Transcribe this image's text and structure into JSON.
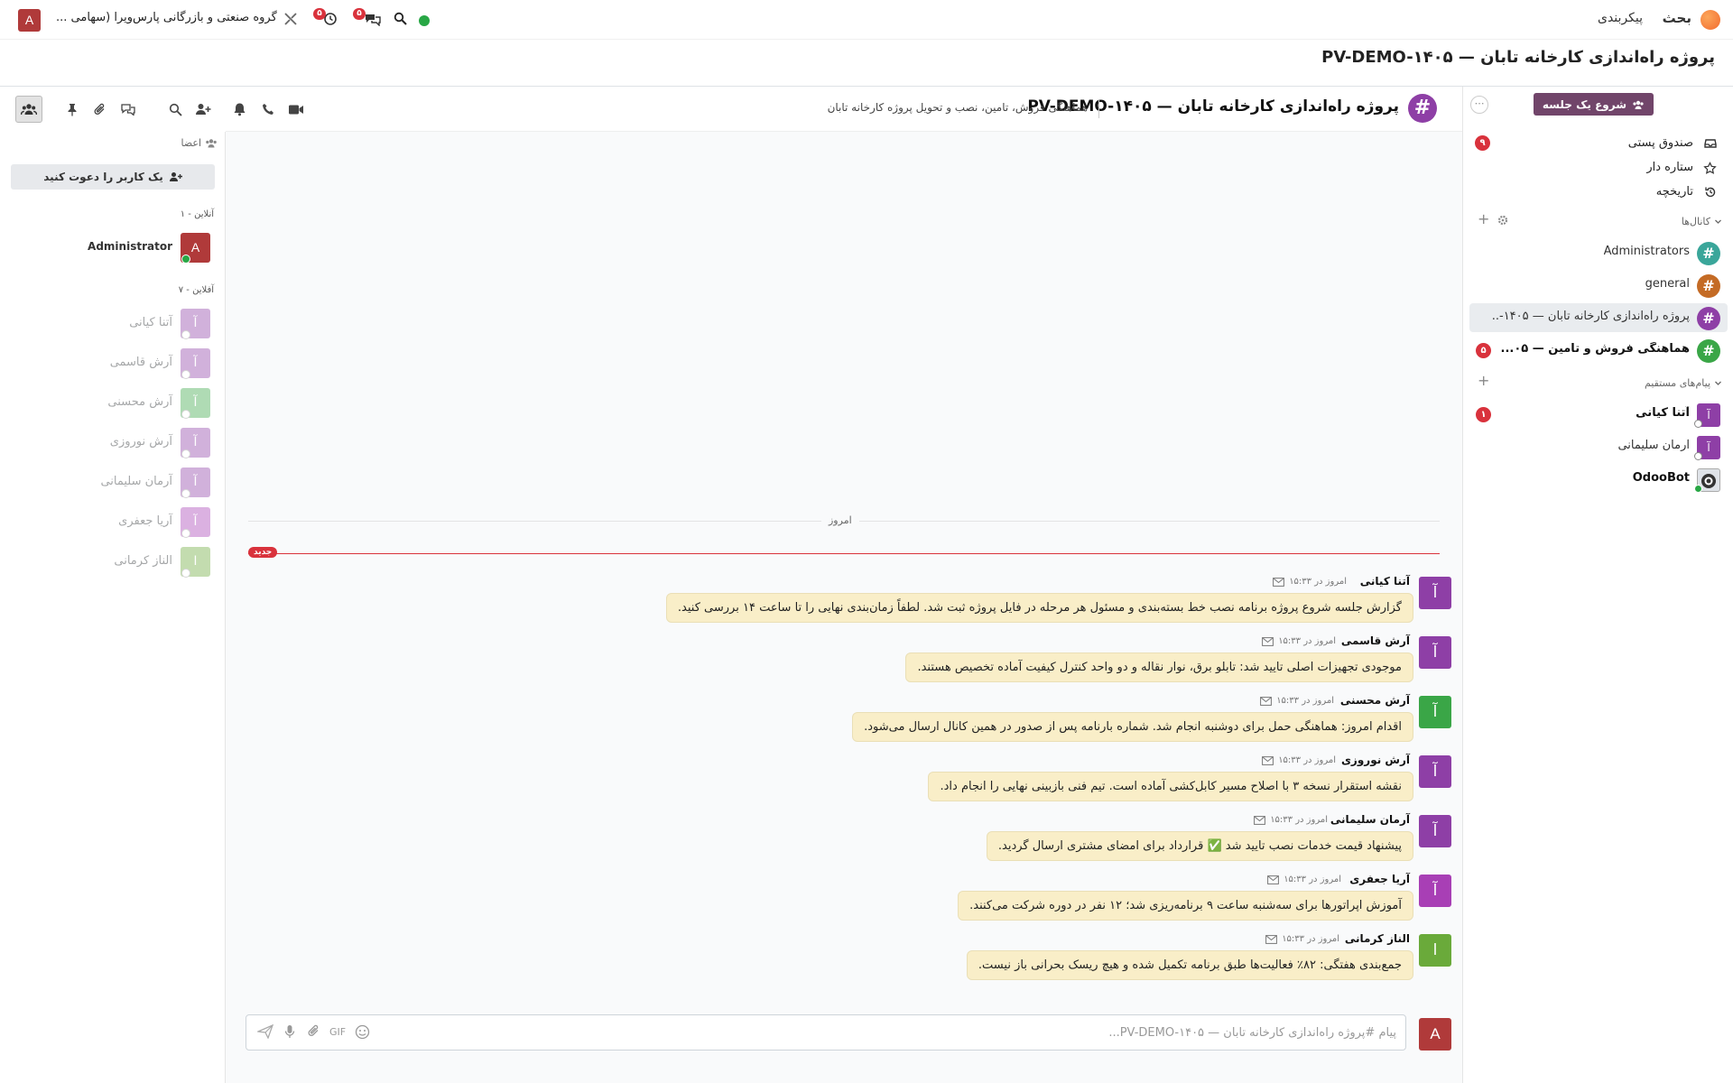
{
  "navbar": {
    "app_name": "بحث",
    "menu_item": "پیکربندی",
    "company": "گروه صنعتی و بازرگانی پارس‌ویرا (سهامی ...",
    "user_initial": "A",
    "messages_badge": "۵",
    "activity_badge": "۵"
  },
  "breadcrumb": {
    "title": "پروژه راه‌اندازی کارخانه تابان — PV-DEMO-۱۴۰۵"
  },
  "sidebar": {
    "start_meeting": "شروع یک جلسه",
    "mailboxes": [
      {
        "label": "صندوق پستی",
        "icon": "inbox-icon",
        "badge": "۹"
      },
      {
        "label": "ستاره دار",
        "icon": "star-icon",
        "badge": ""
      },
      {
        "label": "تاریخچه",
        "icon": "history-icon",
        "badge": ""
      }
    ],
    "channels_header": "کانال‌ها",
    "channels": [
      {
        "name": "Administrators",
        "color": "#3aa69a",
        "bold": false,
        "active": false,
        "badge": ""
      },
      {
        "name": "general",
        "color": "#c46b25",
        "bold": false,
        "active": false,
        "badge": ""
      },
      {
        "name": "پروژه راه‌اندازی کارخانه تابان — ۱۴۰۵-...",
        "color": "#8e3fa6",
        "bold": false,
        "active": true,
        "badge": ""
      },
      {
        "name": "هماهنگی فروش و تامین — ۰۵...",
        "color": "#3aa647",
        "bold": true,
        "active": false,
        "badge": "۵"
      }
    ],
    "dm_header": "پیام‌های مستقیم",
    "direct_messages": [
      {
        "name": "آتنا کیانی",
        "initial": "آ",
        "color": "#8e3fa6",
        "bold": true,
        "badge": "۱",
        "online": false
      },
      {
        "name": "آرمان سلیمانی",
        "initial": "آ",
        "color": "#8e3fa6",
        "bold": false,
        "badge": "",
        "online": false
      },
      {
        "name": "OdooBot",
        "initial": "",
        "color": "#444",
        "bold": true,
        "badge": "",
        "online": true
      }
    ]
  },
  "channel": {
    "name": "پروژه راه‌اندازی کارخانه تابان — PV-DEMO-۱۴۰۵",
    "description": "هماهنگی فروش، تامین، نصب و تحویل پروژه کارخانه تابان"
  },
  "thread": {
    "day_label": "امروز",
    "new_label": "جدید",
    "messages": [
      {
        "author": "آتنا کیانی",
        "initial": "آ",
        "color": "#8e3fa6",
        "time": "امروز در ۱۵:۳۳",
        "text": "گزارش جلسه شروع پروژه برنامه نصب خط بسته‌بندی و مسئول هر مرحله در فایل پروژه ثبت شد. لطفاً زمان‌بندی نهایی را تا ساعت ۱۴ بررسی کنید."
      },
      {
        "author": "آرش قاسمی",
        "initial": "آ",
        "color": "#8e3fa6",
        "time": "امروز در ۱۵:۳۳",
        "text": "موجودی تجهیزات اصلی تایید شد: تابلو برق، نوار نقاله و دو واحد کنترل کیفیت آماده تخصیص هستند."
      },
      {
        "author": "آرش محسنی",
        "initial": "آ",
        "color": "#3aa647",
        "time": "امروز در ۱۵:۳۳",
        "text": "اقدام امروز: هماهنگی حمل برای دوشنبه انجام شد. شماره بارنامه پس از صدور در همین کانال ارسال می‌شود."
      },
      {
        "author": "آرش نوروزی",
        "initial": "آ",
        "color": "#8e3fa6",
        "time": "امروز در ۱۵:۳۳",
        "text": "نقشه استقرار نسخه ۳ با اصلاح مسیر کابل‌کشی آماده است. تیم فنی بازبینی نهایی را انجام داد."
      },
      {
        "author": "آرمان سلیمانی",
        "initial": "آ",
        "color": "#8e3fa6",
        "time": "امروز در ۱۵:۳۳",
        "text": "پیشنهاد قیمت خدمات نصب تایید شد ✅ قرارداد برای امضای مشتری ارسال گردید."
      },
      {
        "author": "آریا جعفری",
        "initial": "آ",
        "color": "#a83fb5",
        "time": "امروز در ۱۵:۳۳",
        "text": "آموزش اپراتورها برای سه‌شنبه ساعت ۹ برنامه‌ریزی شد؛ ۱۲ نفر در دوره شرکت می‌کنند."
      },
      {
        "author": "الناز کرمانی",
        "initial": "ا",
        "color": "#6aaa3a",
        "time": "امروز در ۱۵:۳۳",
        "text": "جمع‌بندی هفتگی: ۸۲٪ فعالیت‌ها طبق برنامه تکمیل شده و هیچ ریسک بحرانی باز نیست."
      }
    ]
  },
  "composer": {
    "placeholder": "پیام #پروژه راه‌اندازی کارخانه تابان — PV-DEMO-۱۴۰۵...",
    "user_initial": "A",
    "gif_label": "GIF"
  },
  "members": {
    "header": "اعضا",
    "invite": "یک کاربر را دعوت کنید",
    "online_header": "آنلاین - ۱",
    "offline_header": "آفلاین - ۷",
    "online": [
      {
        "name": "Administrator",
        "initial": "A",
        "color": "#b03a3a"
      }
    ],
    "offline": [
      {
        "name": "آتنا کیانی",
        "initial": "آ",
        "color": "#8e3fa6"
      },
      {
        "name": "آرش قاسمی",
        "initial": "آ",
        "color": "#8e3fa6"
      },
      {
        "name": "آرش محسنی",
        "initial": "آ",
        "color": "#3aa647"
      },
      {
        "name": "آرش نوروزی",
        "initial": "آ",
        "color": "#8e3fa6"
      },
      {
        "name": "آرمان سلیمانی",
        "initial": "آ",
        "color": "#8e3fa6"
      },
      {
        "name": "آریا جعفری",
        "initial": "آ",
        "color": "#a83fb5"
      },
      {
        "name": "الناز کرمانی",
        "initial": "ا",
        "color": "#6aaa3a"
      }
    ]
  }
}
